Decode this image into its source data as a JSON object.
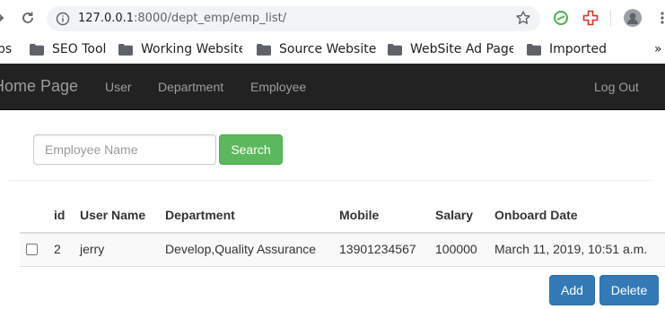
{
  "browser": {
    "url_host": "127.0.0.1",
    "url_rest": ":8000/dept_emp/emp_list/",
    "bookmarks": [
      "ps",
      "SEO Tool",
      "Working Website",
      "Source Website",
      "WebSite Ad Page",
      "Imported"
    ],
    "more": "»"
  },
  "navbar": {
    "brand": "Home Page",
    "links": [
      "User",
      "Department",
      "Employee"
    ],
    "logout": "Log Out"
  },
  "search": {
    "placeholder": "Employee Name",
    "value": "",
    "button_label": "Search"
  },
  "table": {
    "columns": [
      "id",
      "User Name",
      "Department",
      "Mobile",
      "Salary",
      "Onboard Date"
    ],
    "rows": [
      {
        "checked": false,
        "id": "2",
        "username": "jerry",
        "department": "Develop,Quality Assurance",
        "mobile": "13901234567",
        "salary": "100000",
        "onboard_date": "March 11, 2019, 10:51 a.m."
      }
    ]
  },
  "actions": {
    "add_label": "Add",
    "delete_label": "Delete"
  },
  "colors": {
    "navbar_bg": "#222222",
    "navbar_text": "#9d9d9d",
    "success": "#5cb85c",
    "primary": "#337ab7"
  }
}
